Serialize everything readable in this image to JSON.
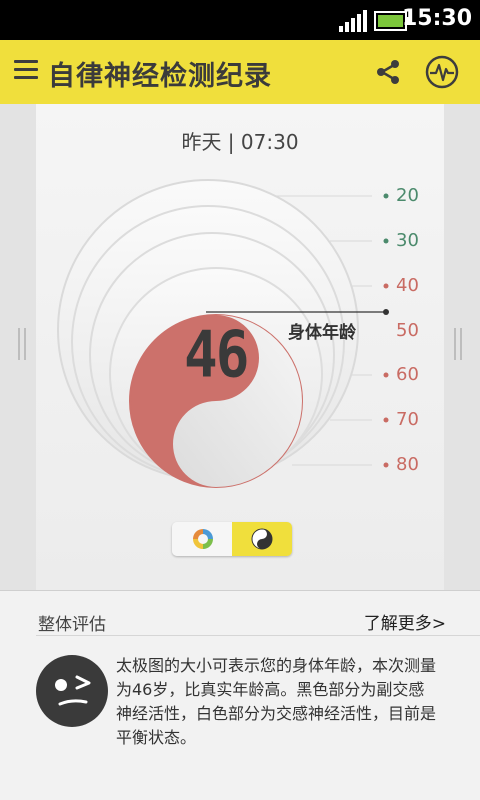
{
  "status_bar": {
    "time": "15:30",
    "icons": [
      "signal-icon",
      "battery-icon"
    ]
  },
  "app_bar": {
    "title": "自律神经检测纪录",
    "icons": [
      "menu-icon",
      "share-icon",
      "pulse-icon"
    ],
    "background": "#f0df3c"
  },
  "record": {
    "date_label": "昨天",
    "time": "07:30"
  },
  "age_chart": {
    "body_age": "46",
    "body_age_label": "身体年龄",
    "ticks": [
      "20",
      "30",
      "40",
      "50",
      "60",
      "70",
      "80"
    ],
    "tick_colors": {
      "green": "#4b8a6c",
      "red": "#c96b63"
    }
  },
  "view_toggle": {
    "options": [
      "donut-chart-icon",
      "yin-yang-icon"
    ],
    "selected": 1
  },
  "evaluation": {
    "title": "整体评估",
    "more_link": "了解更多>",
    "text": "太极图的大小可表示您的身体年龄，本次测量为46岁，比真实年龄高。黑色部分为副交感神经活性，白色部分为交感神经活性，目前是平衡状态。"
  }
}
